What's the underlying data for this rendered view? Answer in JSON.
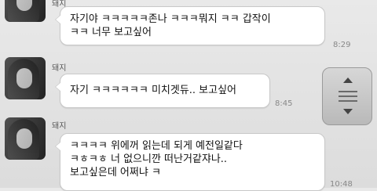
{
  "chat": {
    "messages": [
      {
        "sender": "돼지",
        "text": "자기야 ㅋㅋㅋㅋㅋ존나 ㅋㅋㅋ뭐지 ㅋㅋ 갑작이\nㅋㅋ 너무 보고싶어",
        "time": "8:29"
      },
      {
        "sender": "돼지",
        "text": "자기 ㅋㅋㅋㅋㅋㅋ 미치겟듀.. 보고싶어",
        "time": "8:45"
      },
      {
        "sender": "돼지",
        "text": "ㅋㅋㅋㅋ 위에꺼 읽는데 되게 예전일같다\nㅋㅎㅋㅎ 너 없으니깐 떠난거같쟈나..\n보고싶은데 어쩌냐 ㅋ",
        "time": "10:48"
      }
    ]
  },
  "icons": {
    "avatar": "avatar-photo",
    "scroll": "scroll-control"
  }
}
